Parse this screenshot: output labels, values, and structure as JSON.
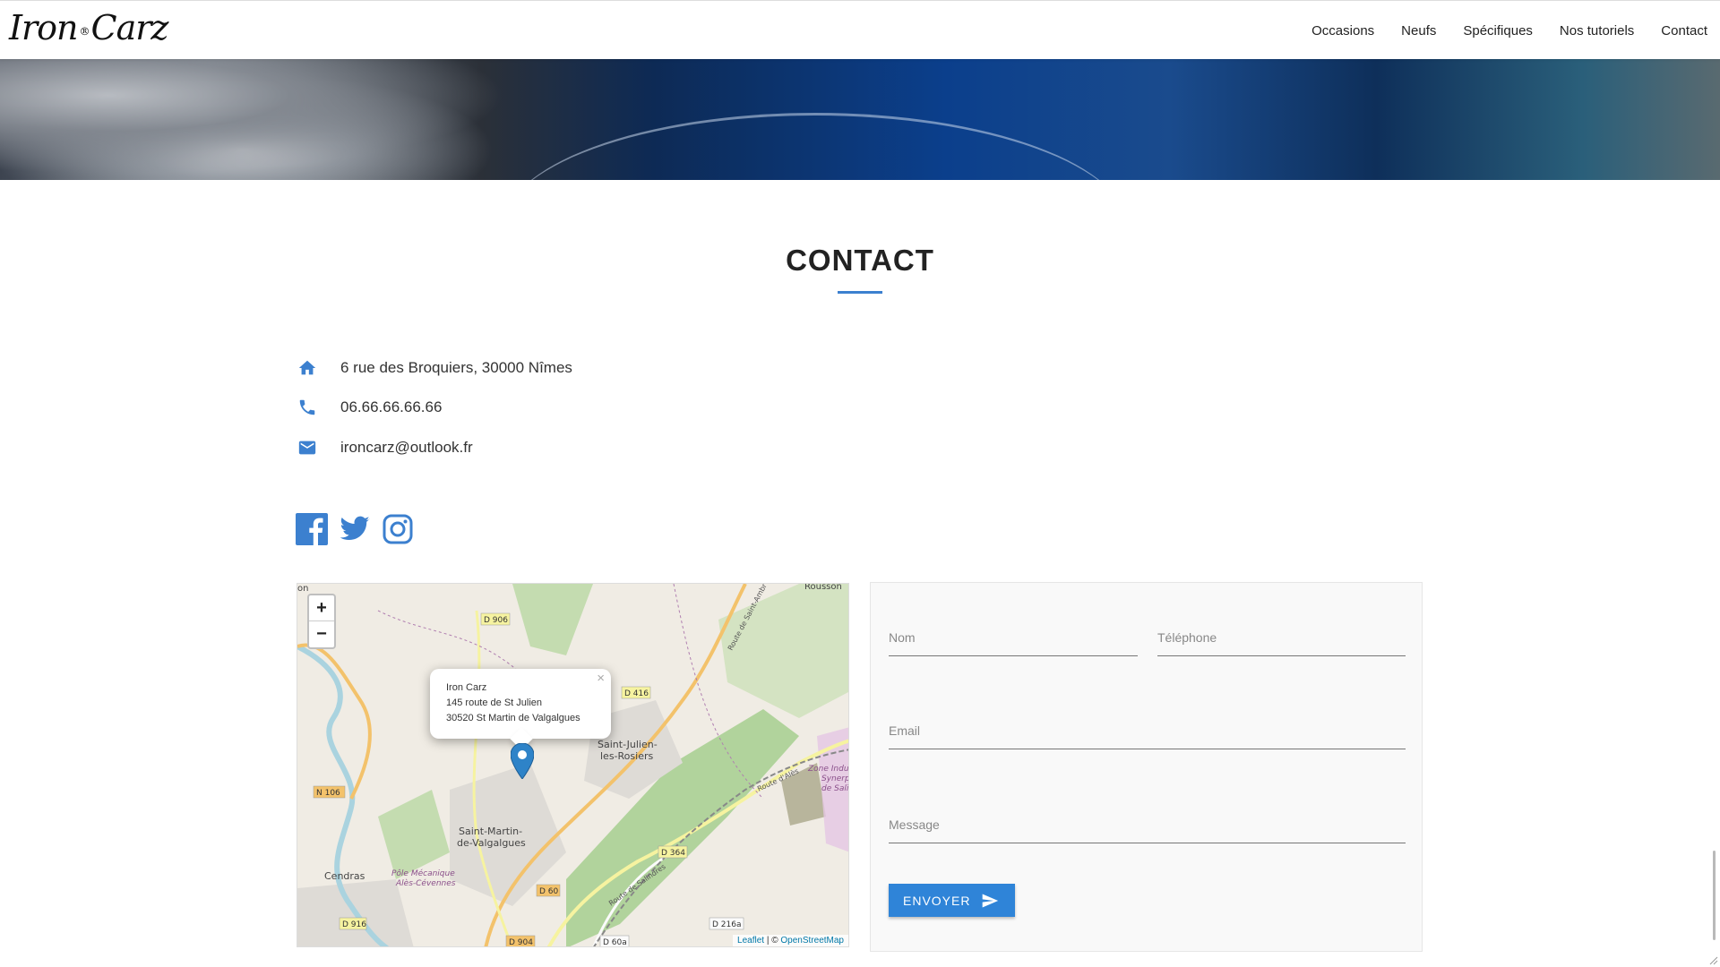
{
  "header": {
    "logo_left": "Iron",
    "logo_dot": "®",
    "logo_right": "Carz",
    "nav": [
      "Occasions",
      "Neufs",
      "Spécifiques",
      "Nos tutoriels",
      "Contact"
    ]
  },
  "contact": {
    "title": "CONTACT",
    "address": "6 rue des Broquiers, 30000 Nîmes",
    "phone": "06.66.66.66.66",
    "email": "ironcarz@outlook.fr",
    "address_icon": "home-icon",
    "phone_icon": "phone-icon",
    "email_icon": "mail-icon",
    "socials": [
      "facebook-icon",
      "twitter-icon",
      "instagram-icon"
    ],
    "accent_color": "#3c80cf"
  },
  "map": {
    "zoom_in": "+",
    "zoom_out": "−",
    "popup": {
      "close": "×",
      "line1": "Iron Carz",
      "line2": "145 route de St Julien",
      "line3": "30520 St Martin de Valgalgues"
    },
    "attribution_leaflet": "Leaflet",
    "attribution_sep": " | © ",
    "attribution_osm": "OpenStreetMap",
    "labels": {
      "d906": "D 906",
      "d416": "D 416",
      "n106": "N 106",
      "d364": "D 364",
      "d60": "D 60",
      "d916": "D 916",
      "d904": "D 904",
      "d60a": "D 60a",
      "d216a": "D 216a",
      "stjulien1": "Saint-Julien-",
      "stjulien2": "les-Rosiers",
      "stmartin1": "Saint-Martin-",
      "stmartin2": "de-Valgalgues",
      "cendras": "Cendras",
      "pole1": "Pôle Mécanique",
      "pole2": "Alès-Cévennes",
      "zone1": "Zone Indus",
      "zone2": "Synerp",
      "zone3": "de Salin",
      "route_saint_ambr": "Route de Saint-Ambr",
      "route_salindres": "Route de Salindres",
      "route_ales": "Route d'Alès",
      "rousson": "Rousson",
      "on": "on"
    }
  },
  "form": {
    "nom": "Nom",
    "telephone": "Téléphone",
    "email": "Email",
    "message": "Message",
    "submit": "ENVOYER"
  }
}
